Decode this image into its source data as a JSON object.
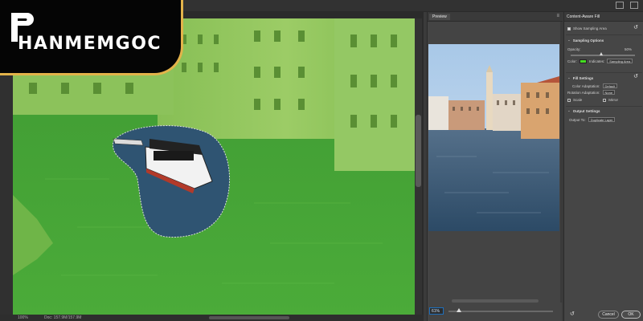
{
  "logo": {
    "text": "HANMEMGOC",
    "border_color": "#e3b34a"
  },
  "status": {
    "zoom": "100%",
    "doc": "Doc: 157.9M/157.9M"
  },
  "preview": {
    "tab": "Preview",
    "menu": "≡",
    "zoom": "61%"
  },
  "panel": {
    "title": "Content-Aware Fill",
    "show_sampling_label": "Show Sampling Area",
    "sampling_section": "Sampling Options",
    "opacity_label": "Opacity:",
    "opacity_value": "50%",
    "color_label": "Color:",
    "indicates_label": "Indicates:",
    "indicates_value": "Sampling Area",
    "fill_section": "Fill Settings",
    "color_adapt_label": "Color Adaptation:",
    "color_adapt_value": "Default",
    "rotation_label": "Rotation Adaptation:",
    "rotation_value": "None",
    "scale_label": "Scale",
    "mirror_label": "Mirror",
    "output_section": "Output Settings",
    "output_label": "Output To:",
    "output_value": "Duplicate Layer",
    "cancel_label": "Cancel",
    "ok_label": "OK",
    "overlay_color": "#44dd22"
  }
}
